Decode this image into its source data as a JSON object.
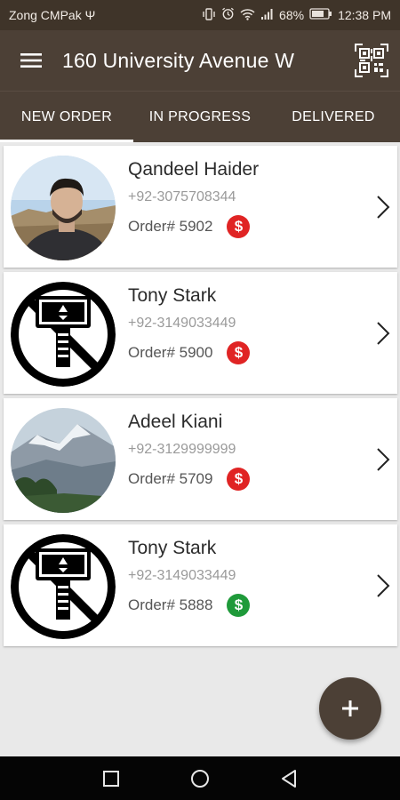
{
  "status_bar": {
    "carrier": "Zong CMPak Ψ",
    "battery": "68%",
    "time": "12:38 PM",
    "icons": [
      "vibrate-icon",
      "alarm-icon",
      "wifi-icon",
      "signal-icon",
      "battery-icon"
    ]
  },
  "app_bar": {
    "title": "160 University Avenue W",
    "menu_icon": "hamburger-menu-icon",
    "qr_icon": "qr-code-scan-icon"
  },
  "tabs": [
    {
      "label": "NEW ORDER",
      "active": true
    },
    {
      "label": "IN PROGRESS",
      "active": false
    },
    {
      "label": "DELIVERED",
      "active": false
    }
  ],
  "orders": [
    {
      "name": "Qandeel Haider",
      "phone": "+92-3075708344",
      "order": "Order# 5902",
      "payment": "unpaid",
      "avatar": "person-photo"
    },
    {
      "name": "Tony Stark",
      "phone": "+92-3149033449",
      "order": "Order# 5900",
      "payment": "unpaid",
      "avatar": "hammer-logo"
    },
    {
      "name": "Adeel Kiani",
      "phone": "+92-3129999999",
      "order": "Order# 5709",
      "payment": "unpaid",
      "avatar": "mountain-photo"
    },
    {
      "name": "Tony Stark",
      "phone": "+92-3149033449",
      "order": "Order# 5888",
      "payment": "paid",
      "avatar": "hammer-logo"
    }
  ],
  "colors": {
    "status_bar": "#3f3429",
    "app_bar": "#4c4036",
    "unpaid": "#e02424",
    "paid": "#1f9a3a"
  },
  "fab": {
    "label": "+",
    "icon": "add-icon"
  },
  "nav": [
    "recents-square-icon",
    "home-circle-icon",
    "back-triangle-icon"
  ]
}
